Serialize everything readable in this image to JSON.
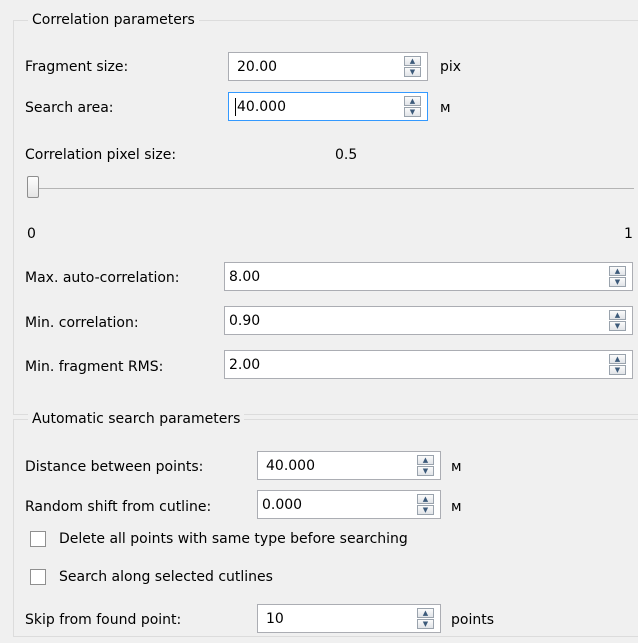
{
  "correlation": {
    "legend": "Correlation parameters",
    "fragment_size": {
      "label": "Fragment size:",
      "value": "20.00",
      "unit": "pix"
    },
    "search_area": {
      "label": "Search area:",
      "value": "40.000",
      "unit": "м"
    },
    "pixel_size": {
      "label": "Correlation pixel size:",
      "value": "0.5",
      "slider_min": "0",
      "slider_max": "1",
      "slider_position": 0
    },
    "max_auto": {
      "label": "Max. auto-correlation:",
      "value": "8.00"
    },
    "min_corr": {
      "label": "Min. correlation:",
      "value": "0.90"
    },
    "min_rms": {
      "label": "Min. fragment RMS:",
      "value": "2.00"
    }
  },
  "automatic": {
    "legend": "Automatic search parameters",
    "distance": {
      "label": "Distance between points:",
      "value": "40.000",
      "unit": "м"
    },
    "random_shift": {
      "label": "Random shift from cutline:",
      "value": "0.000",
      "unit": "м"
    },
    "delete_points": {
      "label": "Delete all points with same type before searching",
      "checked": false
    },
    "search_along": {
      "label": "Search along selected cutlines",
      "checked": false
    },
    "skip": {
      "label": "Skip from found point:",
      "value": "10",
      "unit": "points"
    }
  },
  "icons": {
    "spin_up": "spin-up-arrow-icon",
    "spin_down": "spin-down-arrow-icon"
  }
}
